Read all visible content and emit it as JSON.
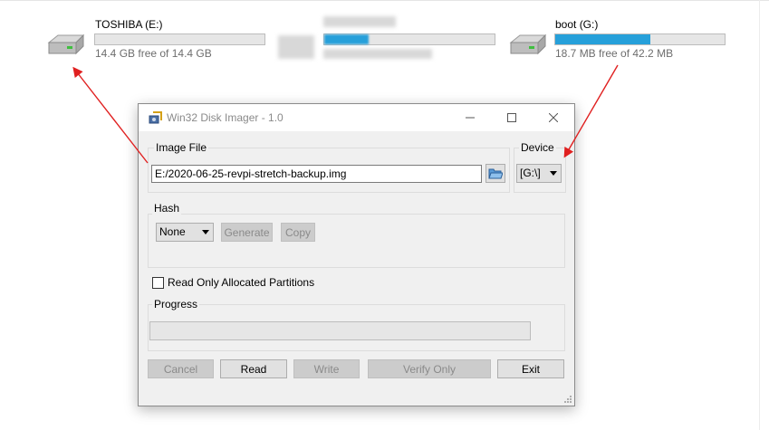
{
  "drives": [
    {
      "name": "TOSHIBA (E:)",
      "free": "14.4 GB free of 14.4 GB",
      "used_fraction": 0.0
    },
    {
      "name": "",
      "free": "",
      "used_fraction": 0.26,
      "blurred": true
    },
    {
      "name": "boot (G:)",
      "free": "18.7 MB free of 42.2 MB",
      "used_fraction": 0.56
    }
  ],
  "colors": {
    "drive_fill": "#26a0da",
    "arrow": "#e02020",
    "dialog_bg": "#f0f0f0"
  },
  "dialog": {
    "title": "Win32 Disk Imager - 1.0",
    "image_file_label": "Image File",
    "image_file_path": "E:/2020-06-25-revpi-stretch-backup.img",
    "device_label": "Device",
    "device_value": "[G:\\]",
    "hash_label": "Hash",
    "hash_value": "None",
    "generate_label": "Generate",
    "copy_label": "Copy",
    "read_only_label": "Read Only Allocated Partitions",
    "read_only_checked": false,
    "progress_label": "Progress",
    "progress_value": 0,
    "buttons": {
      "cancel": "Cancel",
      "read": "Read",
      "write": "Write",
      "verify": "Verify Only",
      "exit": "Exit"
    }
  },
  "icons": [
    "drive-icon",
    "disk-imager-icon",
    "minimize-icon",
    "maximize-icon",
    "close-icon",
    "folder-open-icon",
    "resize-grip-icon"
  ]
}
